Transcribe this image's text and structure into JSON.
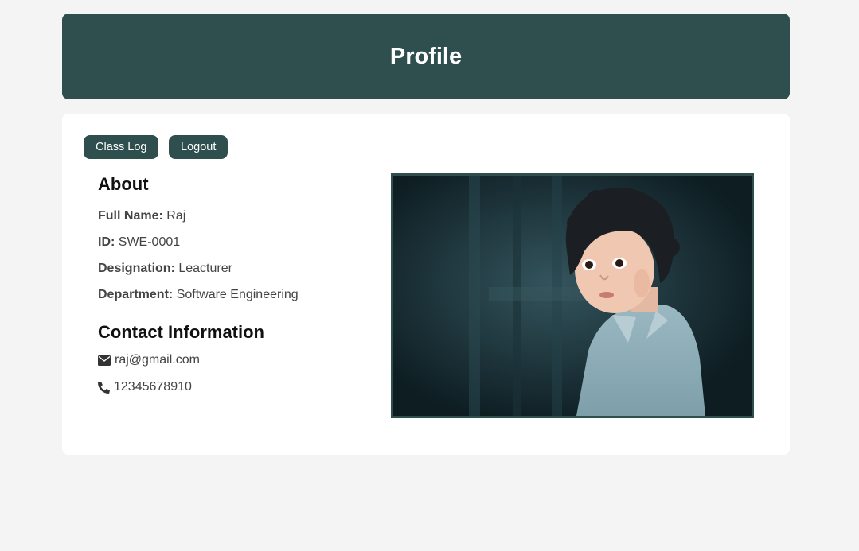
{
  "header": {
    "title": "Profile"
  },
  "toolbar": {
    "class_log_label": "Class Log",
    "logout_label": "Logout"
  },
  "about": {
    "heading": "About",
    "fields": [
      {
        "label": "Full Name:",
        "value": "Raj"
      },
      {
        "label": "ID:",
        "value": "SWE-0001"
      },
      {
        "label": "Designation:",
        "value": "Leacturer"
      },
      {
        "label": "Department:",
        "value": "Software Engineering"
      }
    ]
  },
  "contact": {
    "heading": "Contact Information",
    "email": " raj@gmail.com",
    "phone": " 12345678910",
    "email_icon": "envelope-icon",
    "phone_icon": "phone-icon"
  },
  "colors": {
    "primary": "#2f4f4f",
    "background": "#f4f4f4",
    "card": "#ffffff"
  }
}
